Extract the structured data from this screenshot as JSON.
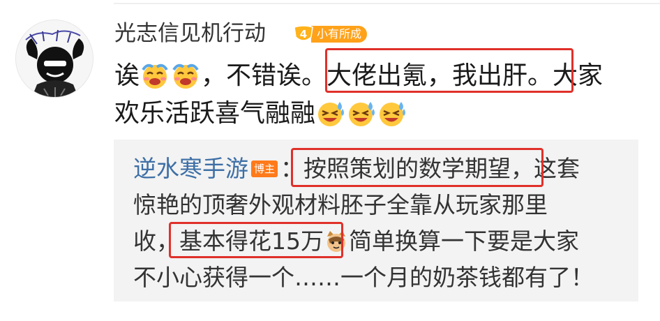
{
  "post": {
    "username": "光志信见机行动",
    "level_number": "4",
    "level_label": "小有所成",
    "comment": {
      "line1_part1": "诶",
      "line1_part2": "，不错诶",
      "line1_highlight": "。大佬出氪，我出肝。",
      "line1_part3": "大家",
      "line2_part1": "欢乐活跃喜气融融",
      "emojis_line1": [
        "laugh-cry-icon",
        "laugh-cry-icon"
      ],
      "emojis_line2": [
        "grin-sweat-icon",
        "grin-sweat-icon",
        "grin-sweat-icon"
      ]
    },
    "highlight_color": "#e0302a"
  },
  "quote": {
    "author": "逆水寒手游",
    "badge": "博主",
    "line1_highlight": "：按照策划的数学期望，",
    "line1_rest": "这套",
    "line2": "惊艳的顶奢外观材料胚子全靠从玩家那里",
    "line3_prefix": "收，",
    "line3_highlight": "基本得花15万",
    "line3_rest": "简单换算一下要是大家",
    "line4": "不小心获得一个……一个月的奶茶钱都有了！",
    "emoji": "cat-face-icon",
    "author_color": "#3e6fa6"
  },
  "avatar": {
    "icon": "avatar-drawing-icon"
  }
}
